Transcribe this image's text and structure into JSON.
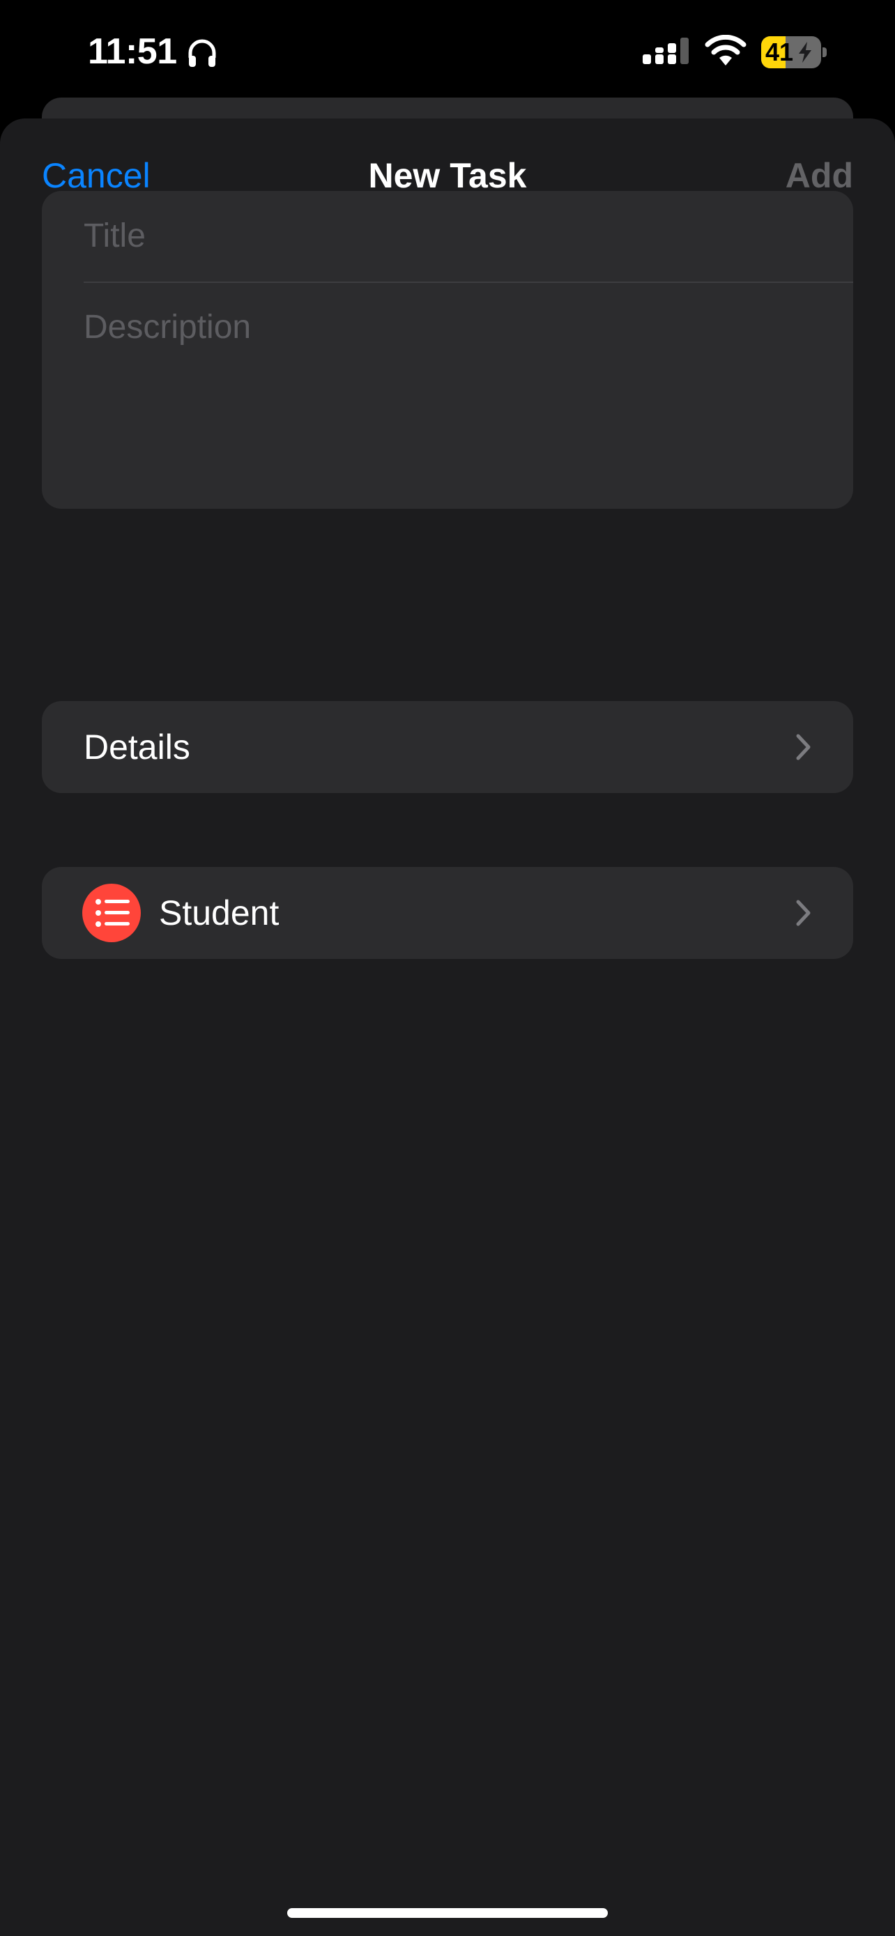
{
  "status_bar": {
    "time": "11:51",
    "battery_percent": "41",
    "battery_level": 0.41,
    "icons": [
      "headphones-icon",
      "cellular-signal-icon",
      "wifi-icon",
      "battery-charging-icon"
    ]
  },
  "nav": {
    "cancel_label": "Cancel",
    "title": "New Task",
    "add_label": "Add"
  },
  "form": {
    "title_placeholder": "Title",
    "title_value": "",
    "description_placeholder": "Description",
    "description_value": ""
  },
  "rows": {
    "details_label": "Details",
    "list_label": "Student",
    "list_icon": "list-bullet-icon",
    "chevron_icon": "chevron-right-icon"
  },
  "colors": {
    "accent": "#0a84ff",
    "add_disabled": "#636366",
    "list_badge": "#ff453a",
    "battery_fill": "#ffd60a",
    "sheet_background": "#1c1c1e",
    "cell_background": "#2c2c2e"
  }
}
